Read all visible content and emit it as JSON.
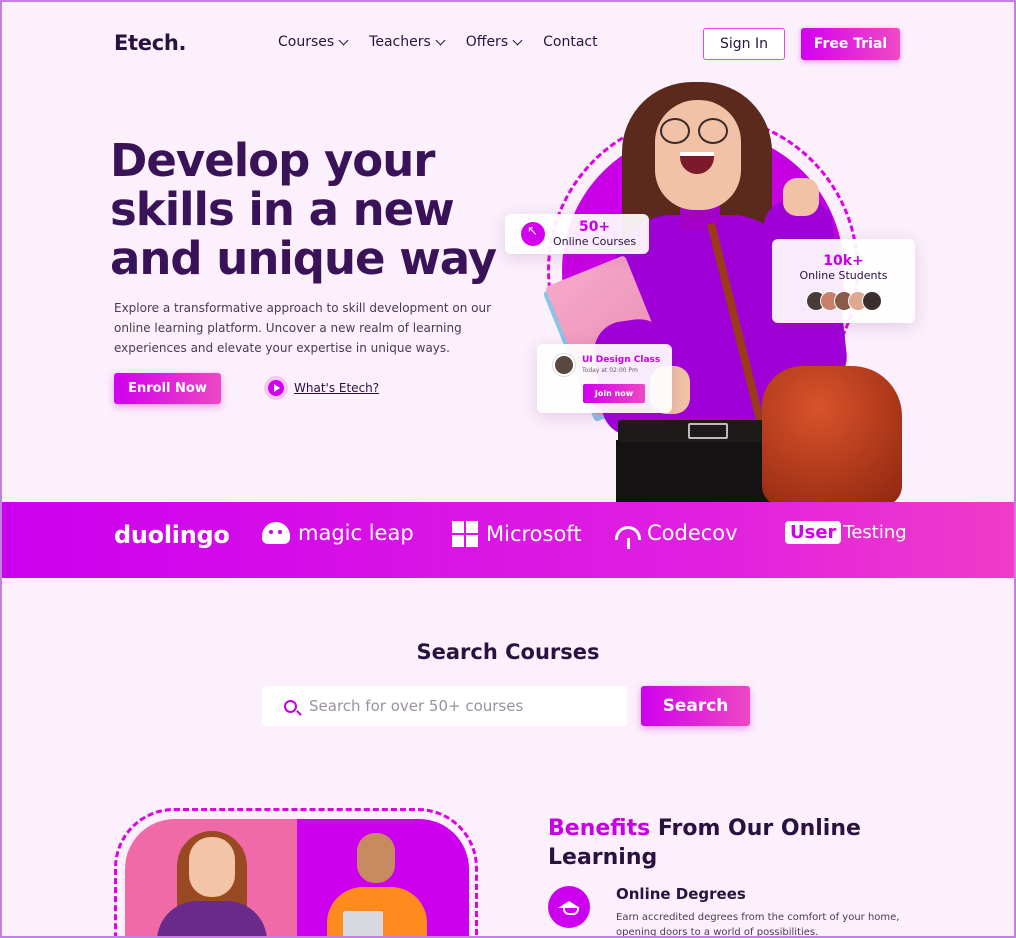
{
  "header": {
    "logo": "Etech.",
    "nav": [
      {
        "label": "Courses",
        "has_dropdown": true
      },
      {
        "label": "Teachers",
        "has_dropdown": true
      },
      {
        "label": "Offers",
        "has_dropdown": true
      },
      {
        "label": "Contact",
        "has_dropdown": false
      }
    ],
    "sign_in": "Sign In",
    "free_trial": "Free Trial"
  },
  "hero": {
    "title": "Develop your skills in a new and unique way",
    "description": "Explore a transformative approach to skill development on our online learning platform. Uncover a new realm of learning experiences and elevate your expertise in unique ways.",
    "enroll": "Enroll Now",
    "whats": "What's Etech?",
    "card_courses": {
      "number": "50+",
      "label": "Online Courses"
    },
    "card_students": {
      "number": "10k+",
      "label": "Online Students"
    },
    "card_class": {
      "title": "UI Design Class",
      "subtitle": "Today at 02:00 Pm",
      "button": "Join now"
    }
  },
  "brands": {
    "duolingo": "duolingo",
    "magic_leap": "magic leap",
    "microsoft": "Microsoft",
    "codecov": "Codecov",
    "usertesting_box": "User",
    "usertesting_rest": "Testing"
  },
  "search": {
    "title": "Search Courses",
    "placeholder": "Search for over 50+ courses",
    "button": "Search"
  },
  "benefits": {
    "title_accent": "Benefits",
    "title_rest": " From Our Online Learning",
    "item_title": "Online Degrees",
    "item_desc": "Earn accredited degrees from the comfort of your home, opening doors to a world of possibilities."
  },
  "colors": {
    "accent": "#d400f0",
    "accent_pink": "#f04ac4",
    "background": "#fbf0fb",
    "heading": "#2a1240"
  }
}
